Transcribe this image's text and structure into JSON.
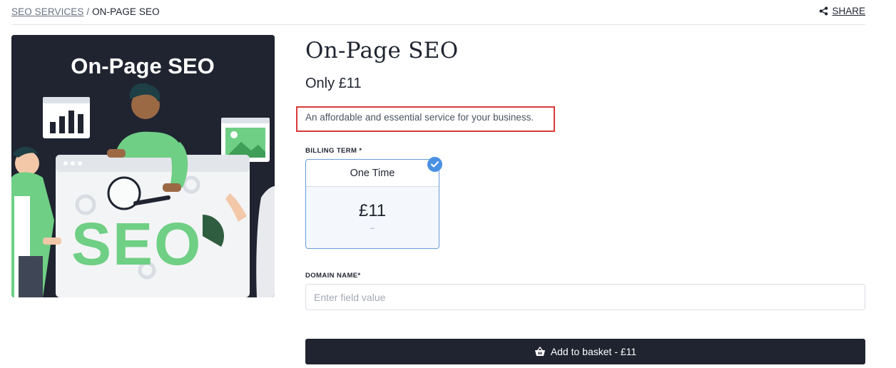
{
  "breadcrumb": {
    "parent": "SEO SERVICES",
    "separator": " / ",
    "current": "ON-PAGE SEO"
  },
  "share": {
    "label": "SHARE",
    "icon": "share-icon"
  },
  "hero": {
    "heading": "On-Page SEO",
    "big_text": "SEO",
    "colors": {
      "background": "#1f2430",
      "accent": "#6fcf84",
      "heading": "#ffffff"
    }
  },
  "product": {
    "title": "On-Page SEO",
    "price": "Only £11",
    "description": "An affordable and essential service for your business."
  },
  "billing": {
    "label": "BILLING TERM *",
    "options": [
      {
        "name": "One Time",
        "price": "£11",
        "sub": "–",
        "selected": true
      }
    ]
  },
  "domain": {
    "label": "DOMAIN NAME*",
    "placeholder": "Enter field value",
    "value": ""
  },
  "basket_button": {
    "label": "Add to basket - £11",
    "icon": "basket-icon"
  },
  "colors": {
    "primary": "#1f2430",
    "selected_border": "#6b9bd8",
    "check": "#4a90e2",
    "highlight": "#d93a3a"
  }
}
